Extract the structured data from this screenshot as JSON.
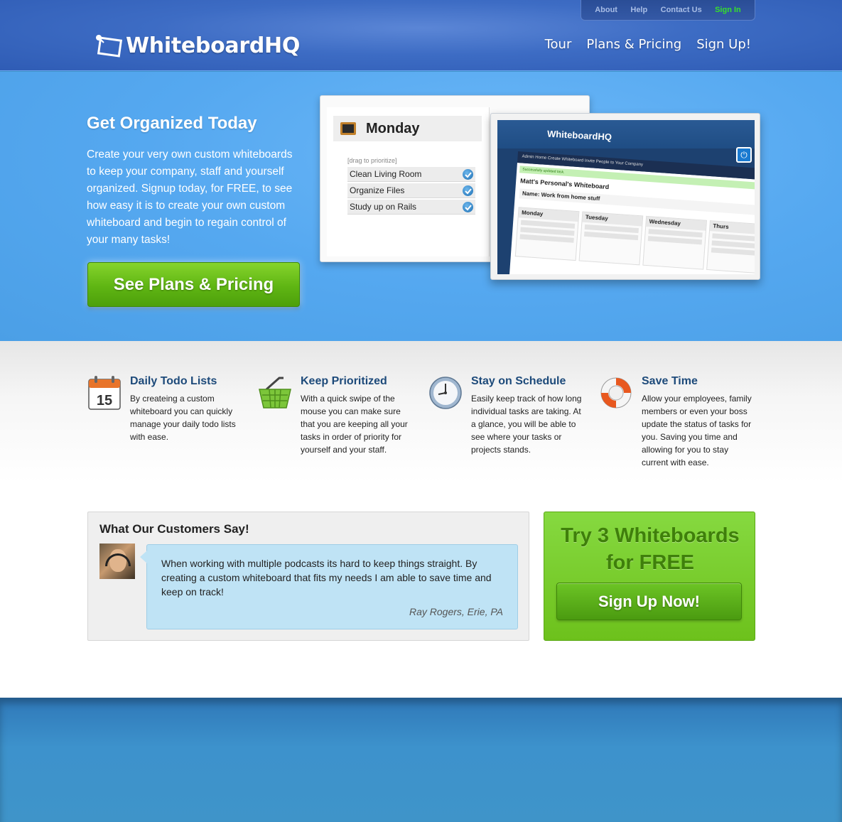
{
  "topbar": {
    "about": "About",
    "help": "Help",
    "contact": "Contact Us",
    "signin": "Sign In"
  },
  "logo": {
    "text": "WhiteboardHQ"
  },
  "nav": {
    "tour": "Tour",
    "plans": "Plans & Pricing",
    "signup": "Sign Up!"
  },
  "hero": {
    "title": "Get Organized Today",
    "text": "Create your very own custom whiteboards to keep your company, staff and yourself organized. Signup today, for FREE, to see how easy it is to create your own custom whiteboard and begin to regain control of your many tasks!",
    "cta": "See Plans & Pricing"
  },
  "mock1": {
    "day": "Monday",
    "drag_note": "[drag to prioritize]",
    "tasks": [
      "Clean Living Room",
      "Organize Files",
      "Study up on Rails"
    ]
  },
  "mock2": {
    "logo": "WhiteboardHQ",
    "nav": "Admin Home     Create Whiteboard     Invite People to Your Company",
    "message": "Successfully updated task.",
    "title": "Matt's Personal's Whiteboard",
    "name": "Name: Work from home stuff",
    "days": [
      "Monday",
      "Tuesday",
      "Wednesday",
      "Thurs"
    ]
  },
  "features": [
    {
      "title": "Daily Todo Lists",
      "text": "By createing a custom whiteboard you can quickly manage your daily todo lists with ease.",
      "icon": "calendar-icon",
      "icon_label": "15"
    },
    {
      "title": "Keep Prioritized",
      "text": "With a quick swipe of the mouse you can make sure that you are keeping all your tasks in order of priority for yourself and your staff.",
      "icon": "basket-icon"
    },
    {
      "title": "Stay on Schedule",
      "text": "Easily keep track of how long individual tasks are taking. At a glance, you will be able to see where your tasks or projects stands.",
      "icon": "clock-icon"
    },
    {
      "title": "Save Time",
      "text": "Allow your employees, family members or even your boss update the status of tasks for you. Saving you time and allowing for you to stay current with ease.",
      "icon": "lifebuoy-icon"
    }
  ],
  "testimonial": {
    "title": "What Our Customers Say!",
    "quote": "When working with multiple podcasts its hard to keep things straight. By creating a custom whiteboard that fits my needs I am able to save time and keep on track!",
    "author": "Ray Rogers, Erie, PA"
  },
  "tryfree": {
    "title_line1": "Try 3 Whiteboards",
    "title_line2": "for FREE",
    "button": "Sign Up Now!"
  },
  "colors": {
    "header": "#3d6cc4",
    "hero": "#55a8f0",
    "green_cta": "#5fb513",
    "signin": "#36e02c",
    "feature_title": "#1d4a7a"
  }
}
